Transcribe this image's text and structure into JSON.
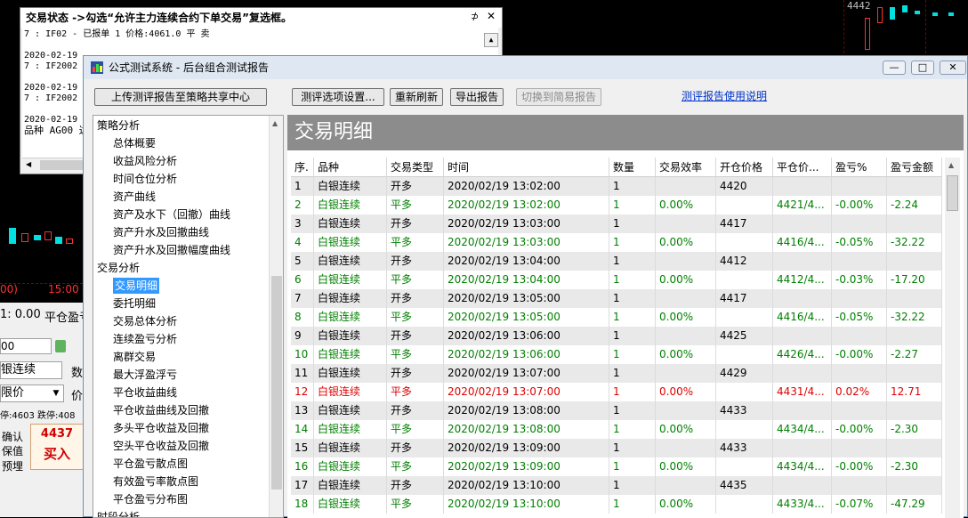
{
  "status_window": {
    "title": "交易状态 ->勾选“允许主力连续合约下单交易”复选框。",
    "pin": "⊅",
    "close": "✕",
    "lines": [
      "7 : IF02 - 已报单 1 价格:4061.0 平 卖",
      "2020-02-19",
      "7 : IF2002",
      "2020-02-19",
      "7 : IF2002",
      "2020-02-19",
      "品种 AG00 达"
    ]
  },
  "bg_chart": {
    "price_label": "4442",
    "time_labels": [
      "00)",
      "15:00"
    ]
  },
  "left_panel": {
    "price_readout": "1: 0.00",
    "pnl_label": "平仓盈亏",
    "account_value": "00",
    "contract": "银连续",
    "qty_label": "数",
    "order_type": "限价",
    "price_label": "价",
    "limit_text": "停:4603 跌停:408",
    "confirm_label": "确认",
    "keep_label": "保值",
    "prebuy_label": "预埋",
    "buy_price": "4437",
    "buy_label": "买入"
  },
  "window": {
    "title": "公式测试系统 - 后台组合测试报告",
    "min_btn": "—",
    "max_btn": "□",
    "close_btn": "✕"
  },
  "toolbar": {
    "upload": "上传测评报告至策略共享中心",
    "options": "测评选项设置...",
    "refresh": "重新刷新",
    "export": "导出报告",
    "switch": "切换到简易报告",
    "help_link": "测评报告使用说明"
  },
  "tree": {
    "items": [
      {
        "label": "策略分析",
        "level": 0
      },
      {
        "label": "总体概要",
        "level": 1
      },
      {
        "label": "收益风险分析",
        "level": 1
      },
      {
        "label": "时间仓位分析",
        "level": 1
      },
      {
        "label": "资产曲线",
        "level": 1
      },
      {
        "label": "资产及水下（回撤）曲线",
        "level": 1
      },
      {
        "label": "资产升水及回撤曲线",
        "level": 1
      },
      {
        "label": "资产升水及回撤幅度曲线",
        "level": 1
      },
      {
        "label": "交易分析",
        "level": 0
      },
      {
        "label": "交易明细",
        "level": 1,
        "selected": true
      },
      {
        "label": "委托明细",
        "level": 1
      },
      {
        "label": "交易总体分析",
        "level": 1
      },
      {
        "label": "连续盈亏分析",
        "level": 1
      },
      {
        "label": "离群交易",
        "level": 1
      },
      {
        "label": "最大浮盈浮亏",
        "level": 1
      },
      {
        "label": "平仓收益曲线",
        "level": 1
      },
      {
        "label": "平仓收益曲线及回撤",
        "level": 1
      },
      {
        "label": "多头平仓收益及回撤",
        "level": 1
      },
      {
        "label": "空头平仓收益及回撤",
        "level": 1
      },
      {
        "label": "平仓盈亏散点图",
        "level": 1
      },
      {
        "label": "有效盈亏率散点图",
        "level": 1
      },
      {
        "label": "平仓盈亏分布图",
        "level": 1
      },
      {
        "label": "时段分析",
        "level": 0
      }
    ]
  },
  "content": {
    "header": "交易明细",
    "columns": [
      "序.",
      "品种",
      "交易类型",
      "时间",
      "数量",
      "交易效率",
      "开仓价格",
      "平仓价...",
      "盈亏%",
      "盈亏金额"
    ],
    "rows": [
      {
        "no": "1",
        "symbol": "白银连续",
        "type": "开多",
        "time": "2020/02/19 13:02:00",
        "qty": "1",
        "eff": "",
        "open": "4420",
        "close": "",
        "pct": "",
        "amt": "",
        "color": "#000000"
      },
      {
        "no": "2",
        "symbol": "白银连续",
        "type": "平多",
        "time": "2020/02/19 13:02:00",
        "qty": "1",
        "eff": "0.00%",
        "open": "",
        "close": "4421/4...",
        "pct": "-0.00%",
        "amt": "-2.24",
        "color": "#008000"
      },
      {
        "no": "3",
        "symbol": "白银连续",
        "type": "开多",
        "time": "2020/02/19 13:03:00",
        "qty": "1",
        "eff": "",
        "open": "4417",
        "close": "",
        "pct": "",
        "amt": "",
        "color": "#000000"
      },
      {
        "no": "4",
        "symbol": "白银连续",
        "type": "平多",
        "time": "2020/02/19 13:03:00",
        "qty": "1",
        "eff": "0.00%",
        "open": "",
        "close": "4416/4...",
        "pct": "-0.05%",
        "amt": "-32.22",
        "color": "#008000"
      },
      {
        "no": "5",
        "symbol": "白银连续",
        "type": "开多",
        "time": "2020/02/19 13:04:00",
        "qty": "1",
        "eff": "",
        "open": "4412",
        "close": "",
        "pct": "",
        "amt": "",
        "color": "#000000"
      },
      {
        "no": "6",
        "symbol": "白银连续",
        "type": "平多",
        "time": "2020/02/19 13:04:00",
        "qty": "1",
        "eff": "0.00%",
        "open": "",
        "close": "4412/4...",
        "pct": "-0.03%",
        "amt": "-17.20",
        "color": "#008000"
      },
      {
        "no": "7",
        "symbol": "白银连续",
        "type": "开多",
        "time": "2020/02/19 13:05:00",
        "qty": "1",
        "eff": "",
        "open": "4417",
        "close": "",
        "pct": "",
        "amt": "",
        "color": "#000000"
      },
      {
        "no": "8",
        "symbol": "白银连续",
        "type": "平多",
        "time": "2020/02/19 13:05:00",
        "qty": "1",
        "eff": "0.00%",
        "open": "",
        "close": "4416/4...",
        "pct": "-0.05%",
        "amt": "-32.22",
        "color": "#008000"
      },
      {
        "no": "9",
        "symbol": "白银连续",
        "type": "开多",
        "time": "2020/02/19 13:06:00",
        "qty": "1",
        "eff": "",
        "open": "4425",
        "close": "",
        "pct": "",
        "amt": "",
        "color": "#000000"
      },
      {
        "no": "10",
        "symbol": "白银连续",
        "type": "平多",
        "time": "2020/02/19 13:06:00",
        "qty": "1",
        "eff": "0.00%",
        "open": "",
        "close": "4426/4...",
        "pct": "-0.00%",
        "amt": "-2.27",
        "color": "#008000"
      },
      {
        "no": "11",
        "symbol": "白银连续",
        "type": "开多",
        "time": "2020/02/19 13:07:00",
        "qty": "1",
        "eff": "",
        "open": "4429",
        "close": "",
        "pct": "",
        "amt": "",
        "color": "#000000"
      },
      {
        "no": "12",
        "symbol": "白银连续",
        "type": "平多",
        "time": "2020/02/19 13:07:00",
        "qty": "1",
        "eff": "0.00%",
        "open": "",
        "close": "4431/4...",
        "pct": "0.02%",
        "amt": "12.71",
        "color": "#e00000"
      },
      {
        "no": "13",
        "symbol": "白银连续",
        "type": "开多",
        "time": "2020/02/19 13:08:00",
        "qty": "1",
        "eff": "",
        "open": "4433",
        "close": "",
        "pct": "",
        "amt": "",
        "color": "#000000"
      },
      {
        "no": "14",
        "symbol": "白银连续",
        "type": "平多",
        "time": "2020/02/19 13:08:00",
        "qty": "1",
        "eff": "0.00%",
        "open": "",
        "close": "4434/4...",
        "pct": "-0.00%",
        "amt": "-2.30",
        "color": "#008000"
      },
      {
        "no": "15",
        "symbol": "白银连续",
        "type": "开多",
        "time": "2020/02/19 13:09:00",
        "qty": "1",
        "eff": "",
        "open": "4433",
        "close": "",
        "pct": "",
        "amt": "",
        "color": "#000000"
      },
      {
        "no": "16",
        "symbol": "白银连续",
        "type": "平多",
        "time": "2020/02/19 13:09:00",
        "qty": "1",
        "eff": "0.00%",
        "open": "",
        "close": "4434/4...",
        "pct": "-0.00%",
        "amt": "-2.30",
        "color": "#008000"
      },
      {
        "no": "17",
        "symbol": "白银连续",
        "type": "开多",
        "time": "2020/02/19 13:10:00",
        "qty": "1",
        "eff": "",
        "open": "4435",
        "close": "",
        "pct": "",
        "amt": "",
        "color": "#000000"
      },
      {
        "no": "18",
        "symbol": "白银连续",
        "type": "平多",
        "time": "2020/02/19 13:10:00",
        "qty": "1",
        "eff": "0.00%",
        "open": "",
        "close": "4433/4...",
        "pct": "-0.07%",
        "amt": "-47.29",
        "color": "#008000"
      }
    ]
  }
}
